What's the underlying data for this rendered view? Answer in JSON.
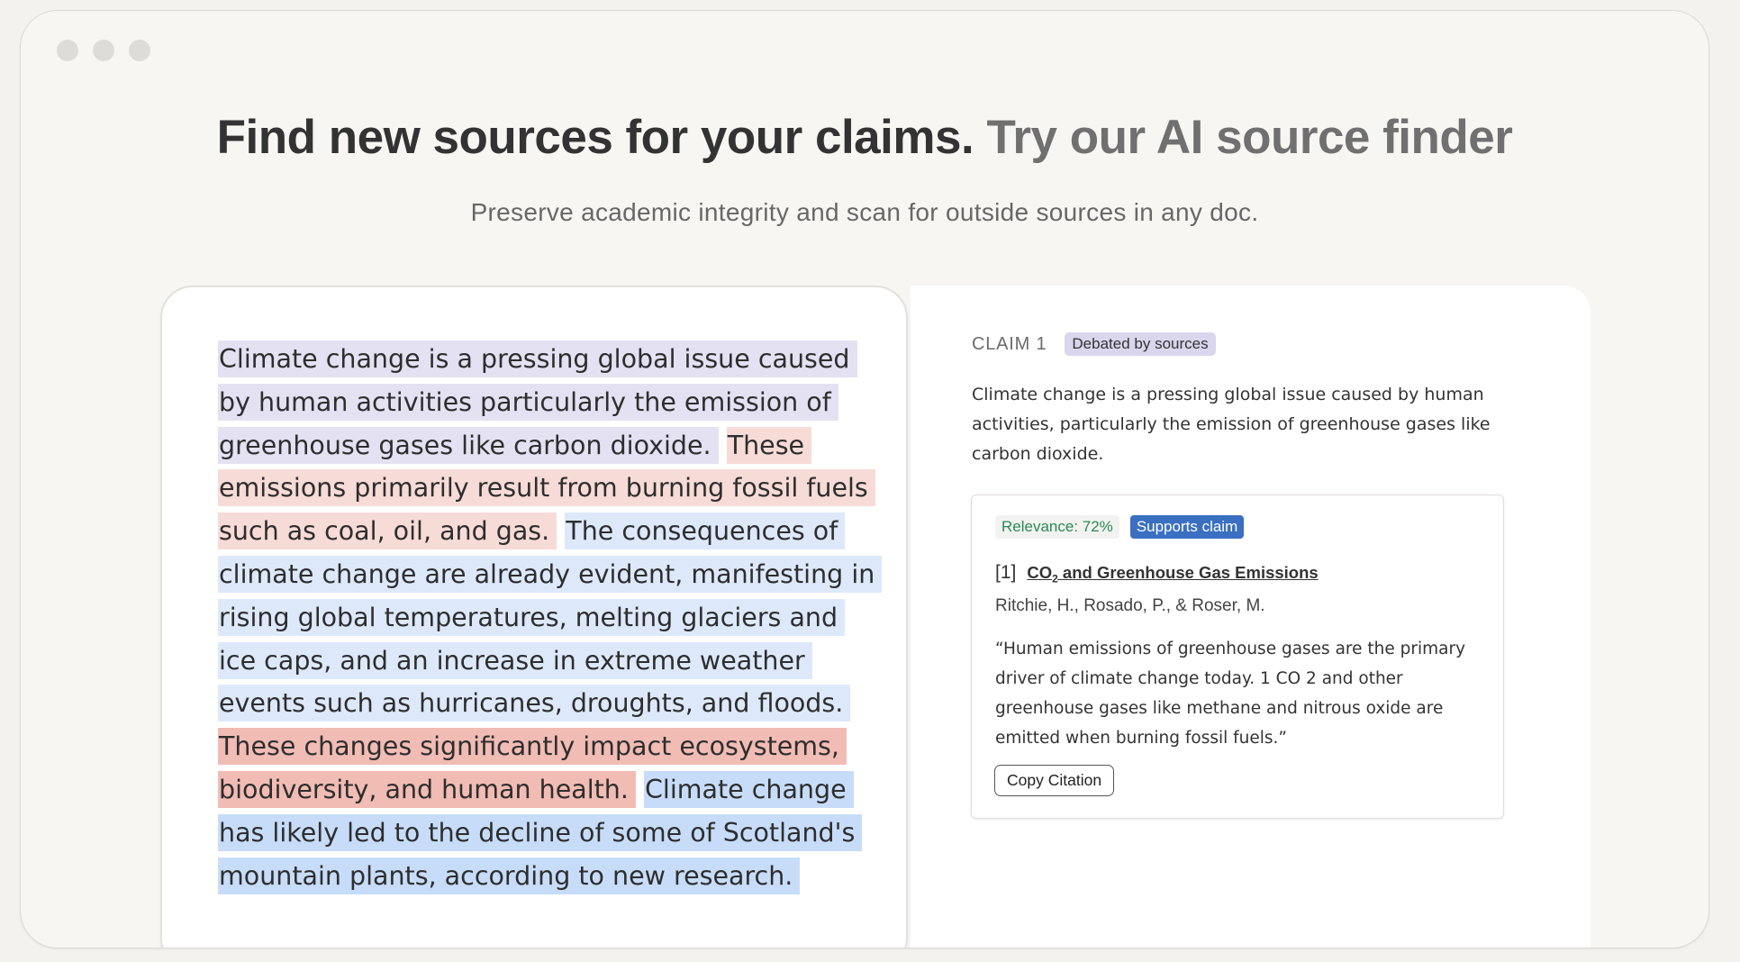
{
  "window": {
    "controls": [
      "window-dot",
      "window-dot",
      "window-dot"
    ]
  },
  "hero": {
    "title_main": "Find new sources for your claims.",
    "title_accent": "Try our AI source finder",
    "subtitle": "Preserve academic integrity and scan for outside sources in any doc."
  },
  "essay": {
    "segments": [
      {
        "text": "Climate change is a pressing global issue caused by human activities particularly the emission of greenhouse gases like carbon dioxide.",
        "highlight": "#e4e1f2"
      },
      {
        "text": "These emissions primarily result from burning fossil fuels such as coal, oil, and gas.",
        "highlight": "#f7dbd7"
      },
      {
        "text": "The consequences of climate change are already evident, manifesting in rising global temperatures, melting glaciers and ice caps, and an increase in extreme weather events such as hurricanes, droughts, and floods.",
        "highlight": "#dde9fb"
      },
      {
        "text": "These changes significantly impact ecosystems, biodiversity, and human health.",
        "highlight": "#f1bcb4"
      },
      {
        "text": "Climate change has likely led to the decline of some of Scotland's mountain plants, according to new research.",
        "highlight": "#c7dcf8"
      }
    ]
  },
  "claim": {
    "label": "CLAIM 1",
    "status_badge": "Debated by sources",
    "text": "Climate change is a pressing global issue caused by human activities, particularly the emission of greenhouse gases like carbon dioxide."
  },
  "source": {
    "relevance": "Relevance: 72%",
    "stance": "Supports claim",
    "ref_number": "[1]",
    "title_prefix": "CO",
    "title_subscript": "2",
    "title_suffix": " and Greenhouse Gas Emissions",
    "authors": "Ritchie, H., Rosado, P., & Roser, M.",
    "quote": "“Human emissions of greenhouse gases are the primary driver of climate change today. 1 CO 2 and other greenhouse gases like methane and nitrous oxide are emitted when burning fossil fuels.”",
    "copy_button": "Copy Citation"
  },
  "colors": {
    "debated_badge": "#d9d6ee",
    "supports_badge": "#3a6fc1",
    "relevance_text": "#2a8a55"
  }
}
